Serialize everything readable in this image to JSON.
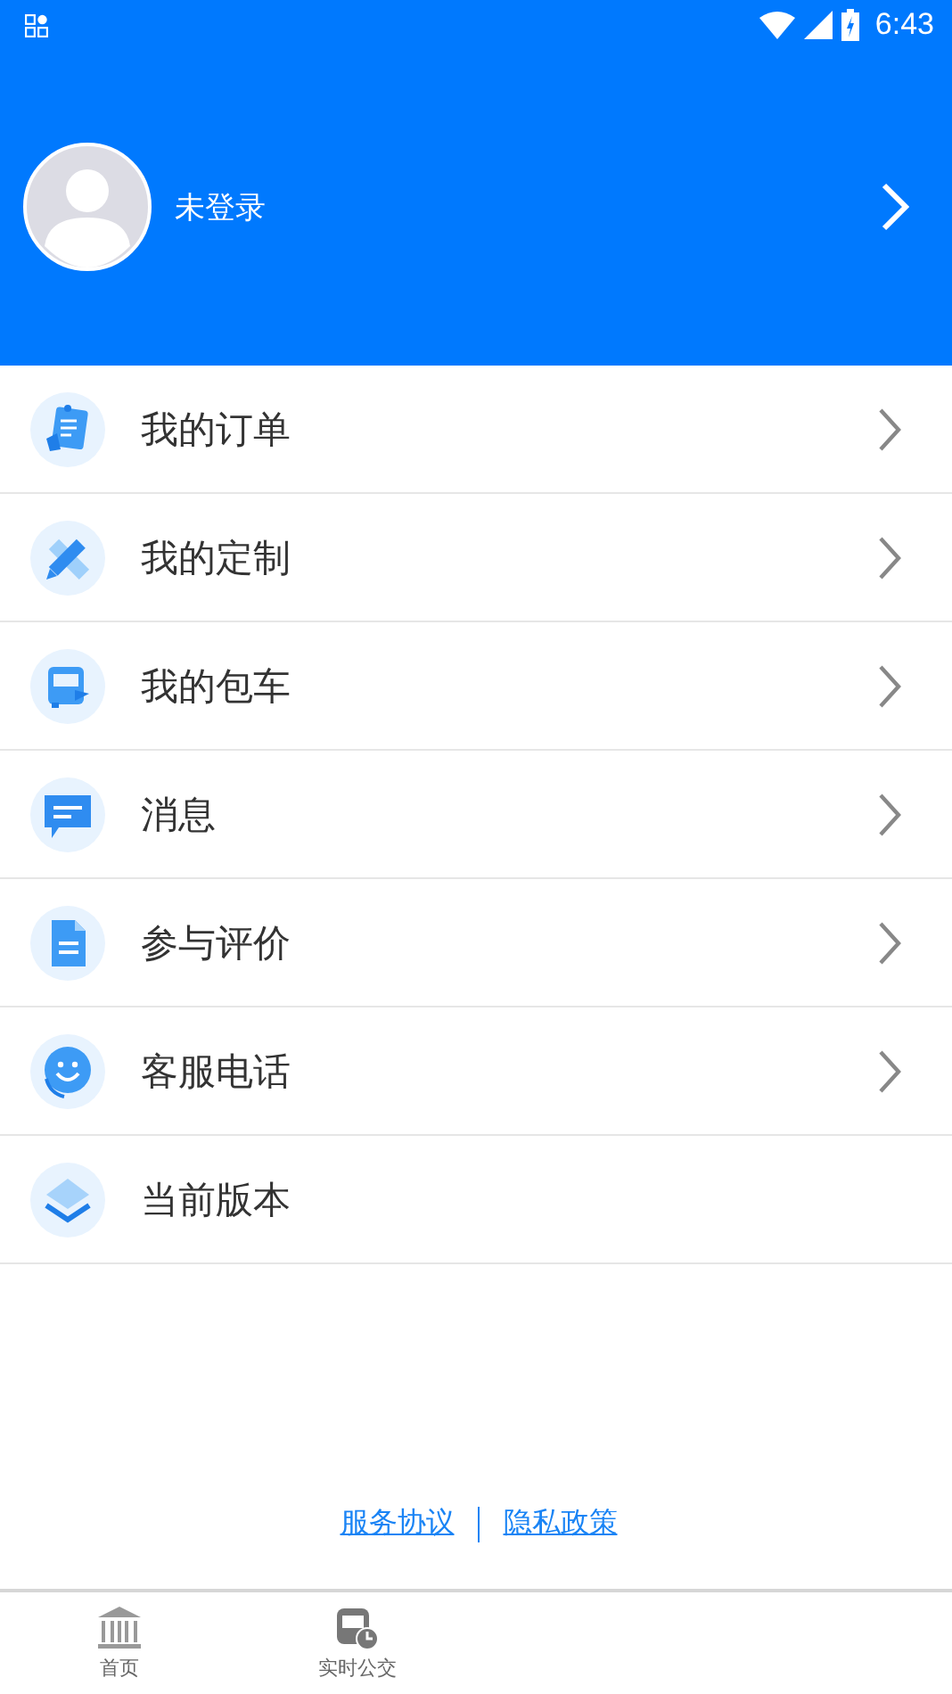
{
  "status_bar": {
    "time": "6:43"
  },
  "profile": {
    "name": "未登录"
  },
  "menu": [
    {
      "label": "我的订单",
      "arrow": true
    },
    {
      "label": "我的定制",
      "arrow": true
    },
    {
      "label": "我的包车",
      "arrow": true
    },
    {
      "label": "消息",
      "arrow": true
    },
    {
      "label": "参与评价",
      "arrow": true
    },
    {
      "label": "客服电话",
      "arrow": true
    },
    {
      "label": "当前版本",
      "arrow": false
    }
  ],
  "links": [
    "服务协议",
    "隐私政策"
  ],
  "bottom_nav": [
    {
      "label": "首页",
      "selected": false
    },
    {
      "label": "实时公交",
      "selected": false
    }
  ]
}
